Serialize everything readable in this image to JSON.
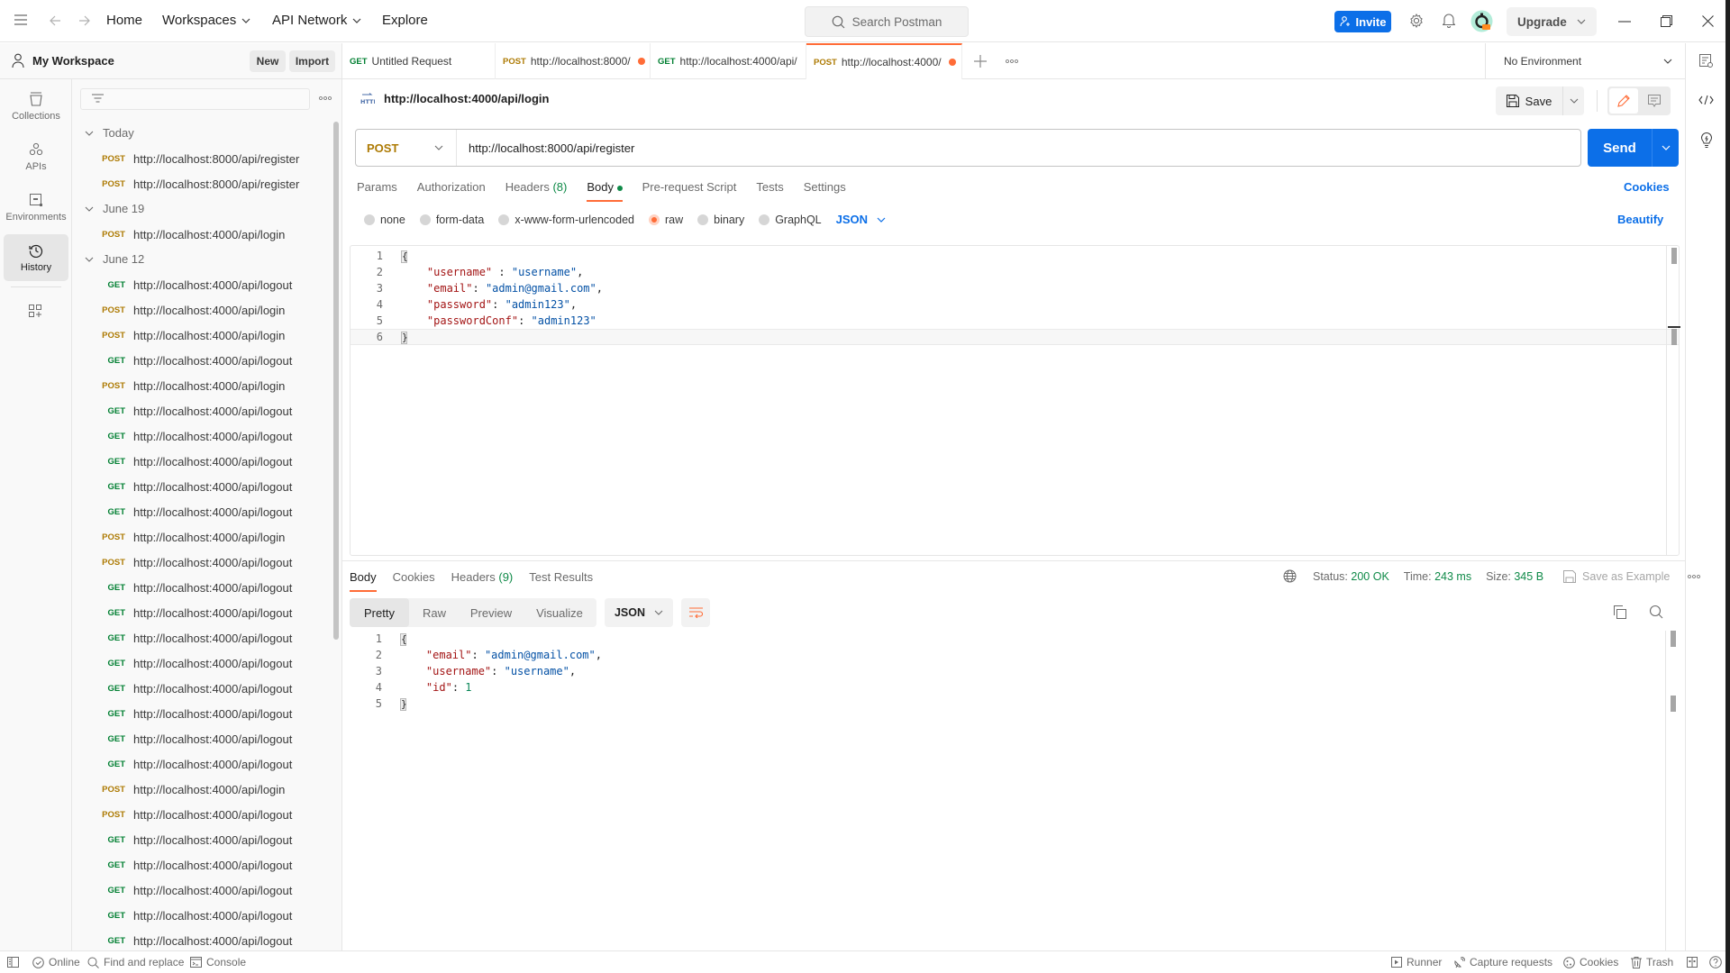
{
  "topbar": {
    "nav": {
      "home": "Home",
      "workspaces": "Workspaces",
      "api_network": "API Network",
      "explore": "Explore"
    },
    "search_placeholder": "Search Postman",
    "invite_label": "Invite",
    "upgrade_label": "Upgrade"
  },
  "workspace": {
    "name": "My Workspace",
    "new_label": "New",
    "import_label": "Import"
  },
  "rail": [
    {
      "label": "Collections",
      "icon": "collections-icon"
    },
    {
      "label": "APIs",
      "icon": "apis-icon"
    },
    {
      "label": "Environments",
      "icon": "environments-icon"
    },
    {
      "label": "History",
      "icon": "history-icon",
      "active": true
    }
  ],
  "history": {
    "groups": [
      {
        "label": "Today",
        "items": [
          {
            "method": "POST",
            "url": "http://localhost:8000/api/register"
          },
          {
            "method": "POST",
            "url": "http://localhost:8000/api/register"
          }
        ]
      },
      {
        "label": "June 19",
        "items": [
          {
            "method": "POST",
            "url": "http://localhost:4000/api/login"
          }
        ]
      },
      {
        "label": "June 12",
        "items": [
          {
            "method": "GET",
            "url": "http://localhost:4000/api/logout"
          },
          {
            "method": "POST",
            "url": "http://localhost:4000/api/login"
          },
          {
            "method": "POST",
            "url": "http://localhost:4000/api/login"
          },
          {
            "method": "GET",
            "url": "http://localhost:4000/api/logout"
          },
          {
            "method": "POST",
            "url": "http://localhost:4000/api/login"
          },
          {
            "method": "GET",
            "url": "http://localhost:4000/api/logout"
          },
          {
            "method": "GET",
            "url": "http://localhost:4000/api/logout"
          },
          {
            "method": "GET",
            "url": "http://localhost:4000/api/logout"
          },
          {
            "method": "GET",
            "url": "http://localhost:4000/api/logout"
          },
          {
            "method": "GET",
            "url": "http://localhost:4000/api/logout"
          },
          {
            "method": "POST",
            "url": "http://localhost:4000/api/login"
          },
          {
            "method": "POST",
            "url": "http://localhost:4000/api/logout"
          },
          {
            "method": "GET",
            "url": "http://localhost:4000/api/logout"
          },
          {
            "method": "GET",
            "url": "http://localhost:4000/api/logout"
          },
          {
            "method": "GET",
            "url": "http://localhost:4000/api/logout"
          },
          {
            "method": "GET",
            "url": "http://localhost:4000/api/logout"
          },
          {
            "method": "GET",
            "url": "http://localhost:4000/api/logout"
          },
          {
            "method": "GET",
            "url": "http://localhost:4000/api/logout"
          },
          {
            "method": "GET",
            "url": "http://localhost:4000/api/logout"
          },
          {
            "method": "GET",
            "url": "http://localhost:4000/api/logout"
          },
          {
            "method": "POST",
            "url": "http://localhost:4000/api/login"
          },
          {
            "method": "POST",
            "url": "http://localhost:4000/api/logout"
          },
          {
            "method": "GET",
            "url": "http://localhost:4000/api/logout"
          },
          {
            "method": "GET",
            "url": "http://localhost:4000/api/logout"
          },
          {
            "method": "GET",
            "url": "http://localhost:4000/api/logout"
          },
          {
            "method": "GET",
            "url": "http://localhost:4000/api/logout"
          },
          {
            "method": "GET",
            "url": "http://localhost:4000/api/logout"
          }
        ]
      }
    ]
  },
  "tabs": [
    {
      "method": "GET",
      "title": "Untitled Request",
      "unsaved": false,
      "active": false
    },
    {
      "method": "POST",
      "title": "http://localhost:8000/",
      "unsaved": true,
      "active": false
    },
    {
      "method": "GET",
      "title": "http://localhost:4000/api/",
      "unsaved": false,
      "active": false
    },
    {
      "method": "POST",
      "title": "http://localhost:4000/",
      "unsaved": true,
      "active": true
    }
  ],
  "environment": {
    "selected": "No Environment"
  },
  "request": {
    "title": "http://localhost:4000/api/login",
    "save_label": "Save",
    "method": "POST",
    "url": "http://localhost:8000/api/register",
    "send_label": "Send",
    "subtabs": [
      {
        "label": "Params"
      },
      {
        "label": "Authorization"
      },
      {
        "label": "Headers",
        "count": "(8)"
      },
      {
        "label": "Body",
        "active": true,
        "indicator": true
      },
      {
        "label": "Pre-request Script"
      },
      {
        "label": "Tests"
      },
      {
        "label": "Settings"
      }
    ],
    "cookies_label": "Cookies",
    "body_types": [
      {
        "label": "none",
        "selected": false
      },
      {
        "label": "form-data",
        "selected": false
      },
      {
        "label": "x-www-form-urlencoded",
        "selected": false
      },
      {
        "label": "raw",
        "selected": true
      },
      {
        "label": "binary",
        "selected": false
      },
      {
        "label": "GraphQL",
        "selected": false
      }
    ],
    "body_language": "JSON",
    "beautify_label": "Beautify",
    "body_lines": [
      {
        "n": "1",
        "text": "{"
      },
      {
        "n": "2",
        "key": "\"username\"",
        "sep": " : ",
        "val": "\"username\"",
        "tail": ","
      },
      {
        "n": "3",
        "key": "\"email\"",
        "sep": ": ",
        "val": "\"admin@gmail.com\"",
        "tail": ","
      },
      {
        "n": "4",
        "key": "\"password\"",
        "sep": ": ",
        "val": "\"admin123\"",
        "tail": ","
      },
      {
        "n": "5",
        "key": "\"passwordConf\"",
        "sep": ": ",
        "val": "\"admin123\"",
        "tail": ""
      },
      {
        "n": "6",
        "text": "}"
      }
    ]
  },
  "response": {
    "tabs": [
      {
        "label": "Body",
        "active": true
      },
      {
        "label": "Cookies"
      },
      {
        "label": "Headers",
        "count": "(9)"
      },
      {
        "label": "Test Results"
      }
    ],
    "status_label": "Status:",
    "status_value": "200 OK",
    "time_label": "Time:",
    "time_value": "243 ms",
    "size_label": "Size:",
    "size_value": "345 B",
    "save_example_label": "Save as Example",
    "formats": [
      {
        "label": "Pretty",
        "active": true
      },
      {
        "label": "Raw"
      },
      {
        "label": "Preview"
      },
      {
        "label": "Visualize"
      }
    ],
    "language": "JSON",
    "body_lines": [
      {
        "n": "1",
        "text": "{"
      },
      {
        "n": "2",
        "key": "\"email\"",
        "sep": ": ",
        "val": "\"admin@gmail.com\"",
        "tail": ",",
        "type": "s"
      },
      {
        "n": "3",
        "key": "\"username\"",
        "sep": ": ",
        "val": "\"username\"",
        "tail": ",",
        "type": "s"
      },
      {
        "n": "4",
        "key": "\"id\"",
        "sep": ": ",
        "val": "1",
        "tail": "",
        "type": "n"
      },
      {
        "n": "5",
        "text": "}"
      }
    ]
  },
  "statusbar": {
    "online": "Online",
    "find_replace": "Find and replace",
    "console": "Console",
    "runner": "Runner",
    "capture": "Capture requests",
    "cookies": "Cookies",
    "trash": "Trash"
  },
  "colors": {
    "accent": "#ff6c37",
    "primary": "#0c6fe8",
    "post": "#ad7a03",
    "get": "#007f31",
    "success": "#0f8a48"
  }
}
